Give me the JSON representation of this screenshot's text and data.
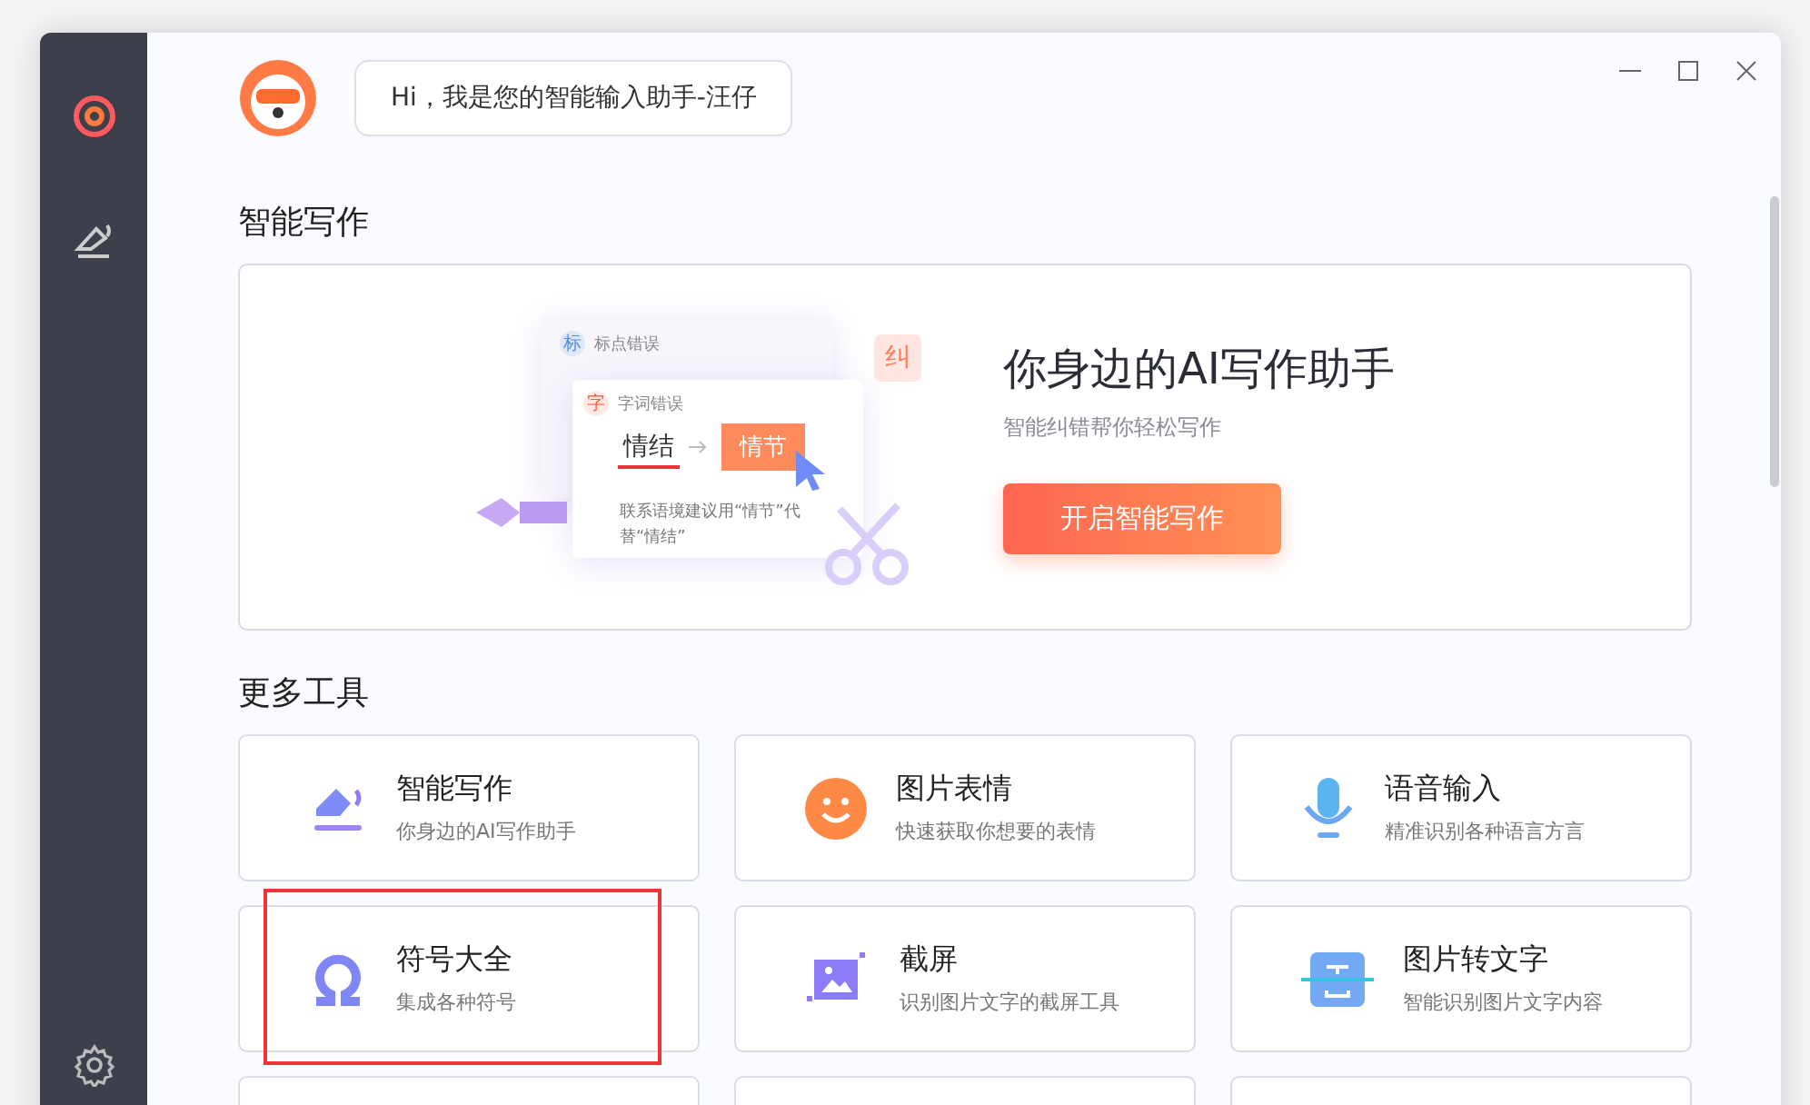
{
  "greeting": "Hi，我是您的智能输入助手-汪仔",
  "section_writing": "智能写作",
  "banner": {
    "badge_punct": "标",
    "label_punct": "标点错误",
    "badge_word": "字",
    "label_word": "字词错误",
    "wrong_word": "情结",
    "right_word": "情节",
    "suggestion": "联系语境建议用“情节”代替“情结”",
    "corner_badge": "纠",
    "title": "你身边的AI写作助手",
    "subtitle": "智能纠错帮你轻松写作",
    "button": "开启智能写作"
  },
  "section_tools": "更多工具",
  "tools": [
    {
      "kind": "pen",
      "title": "智能写作",
      "desc": "你身边的AI写作助手",
      "highlighted": false
    },
    {
      "kind": "smile",
      "title": "图片表情",
      "desc": "快速获取你想要的表情",
      "highlighted": false
    },
    {
      "kind": "mic",
      "title": "语音输入",
      "desc": "精准识别各种语言方言",
      "highlighted": false
    },
    {
      "kind": "omega",
      "title": "符号大全",
      "desc": "集成各种符号",
      "highlighted": true
    },
    {
      "kind": "crop",
      "title": "截屏",
      "desc": "识别图片文字的截屏工具",
      "highlighted": false
    },
    {
      "kind": "scan",
      "title": "图片转文字",
      "desc": "智能识别图片文字内容",
      "highlighted": false
    }
  ]
}
